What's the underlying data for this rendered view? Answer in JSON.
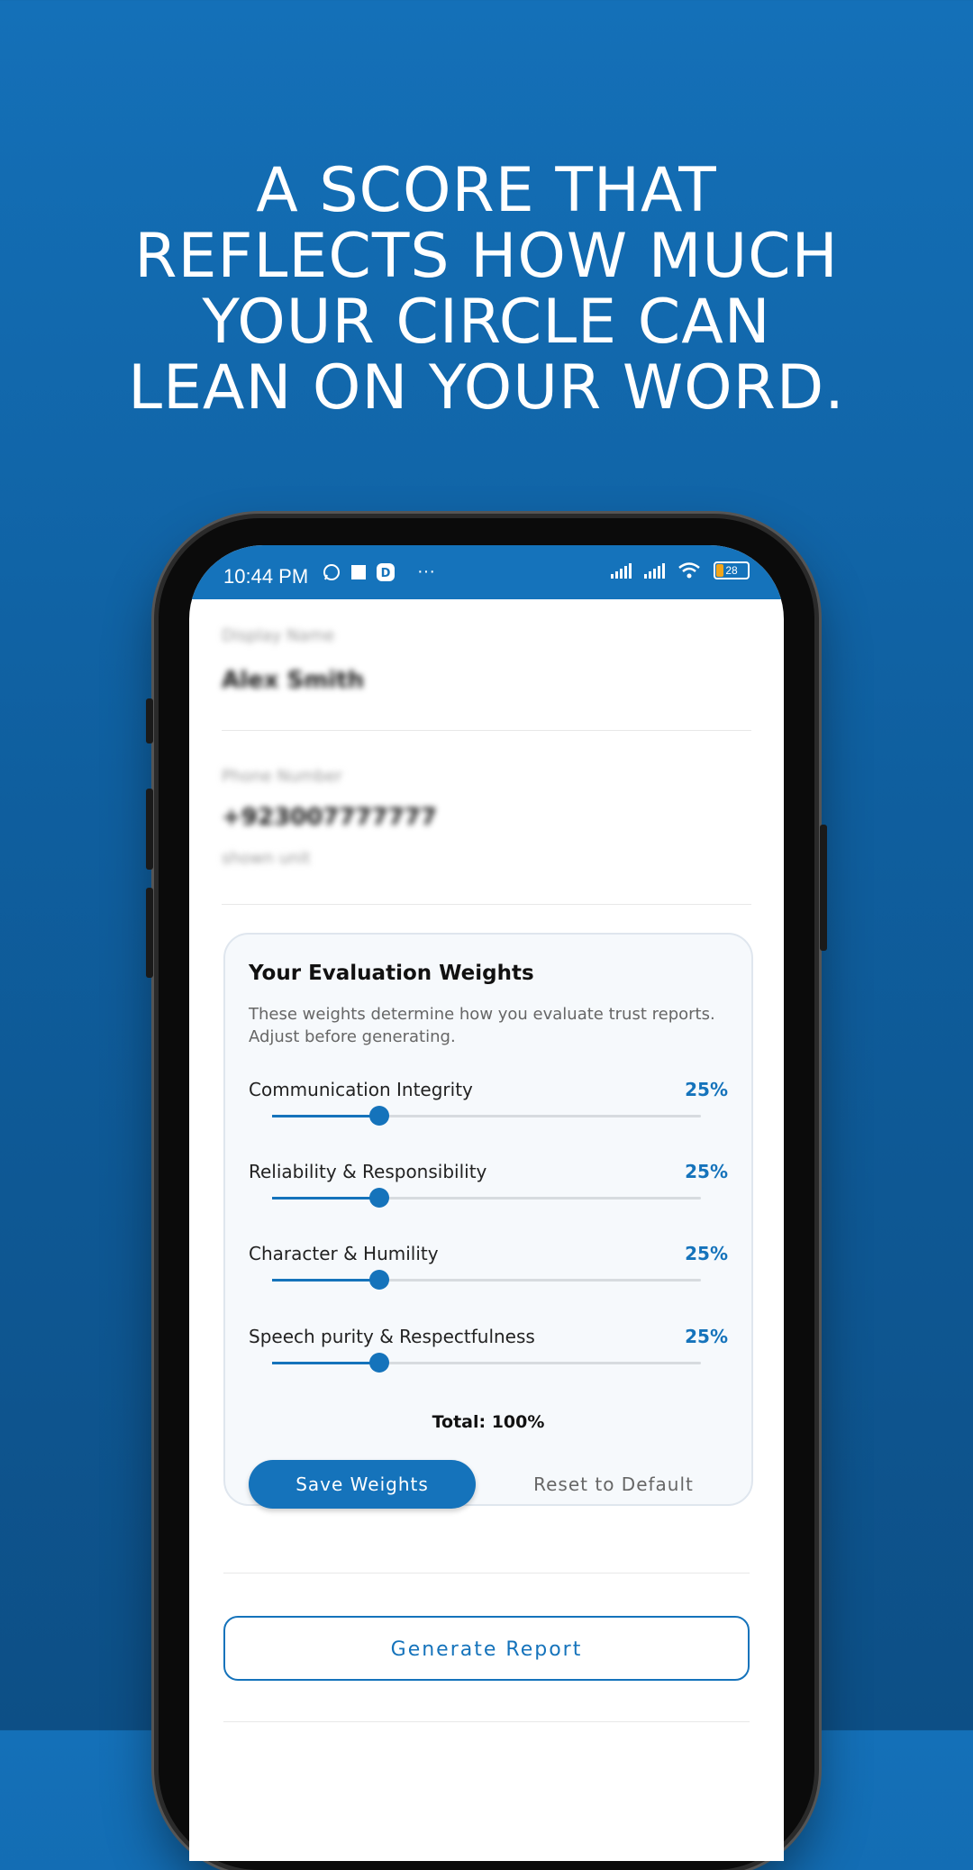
{
  "headline": {
    "line1": "A SCORE THAT",
    "line2": "REFLECTS HOW MUCH",
    "line3": "YOUR CIRCLE CAN",
    "line4": "LEAN ON YOUR WORD."
  },
  "statusbar": {
    "time": "10:44 PM",
    "more": "···",
    "battery": "28",
    "icons": [
      "whatsapp-icon",
      "square-icon",
      "app-icon",
      "signal-icon",
      "signal-icon",
      "wifi-icon",
      "battery-icon"
    ]
  },
  "profile": {
    "display_name_label": "Display Name",
    "display_name_value": "Alex Smith",
    "phone_label": "Phone Number",
    "phone_value": "+923007777777",
    "phone_hint": "shown unit"
  },
  "weights_card": {
    "title": "Your Evaluation Weights",
    "description": "These weights determine how you evaluate trust reports. Adjust before generating.",
    "weights": [
      {
        "label": "Communication Integrity",
        "percent_label": "25%",
        "value": 0.25
      },
      {
        "label": "Reliability & Responsibility",
        "percent_label": "25%",
        "value": 0.25
      },
      {
        "label": "Character & Humility",
        "percent_label": "25%",
        "value": 0.25
      },
      {
        "label": "Speech purity & Respectfulness",
        "percent_label": "25%",
        "value": 0.25
      }
    ],
    "total": "Total: 100%",
    "save_label": "Save Weights",
    "reset_label": "Reset to Default"
  },
  "generate_label": "Generate Report",
  "colors": {
    "accent": "#1573bb",
    "background_top": "#1470b8",
    "background_bottom": "#0d4f86"
  }
}
